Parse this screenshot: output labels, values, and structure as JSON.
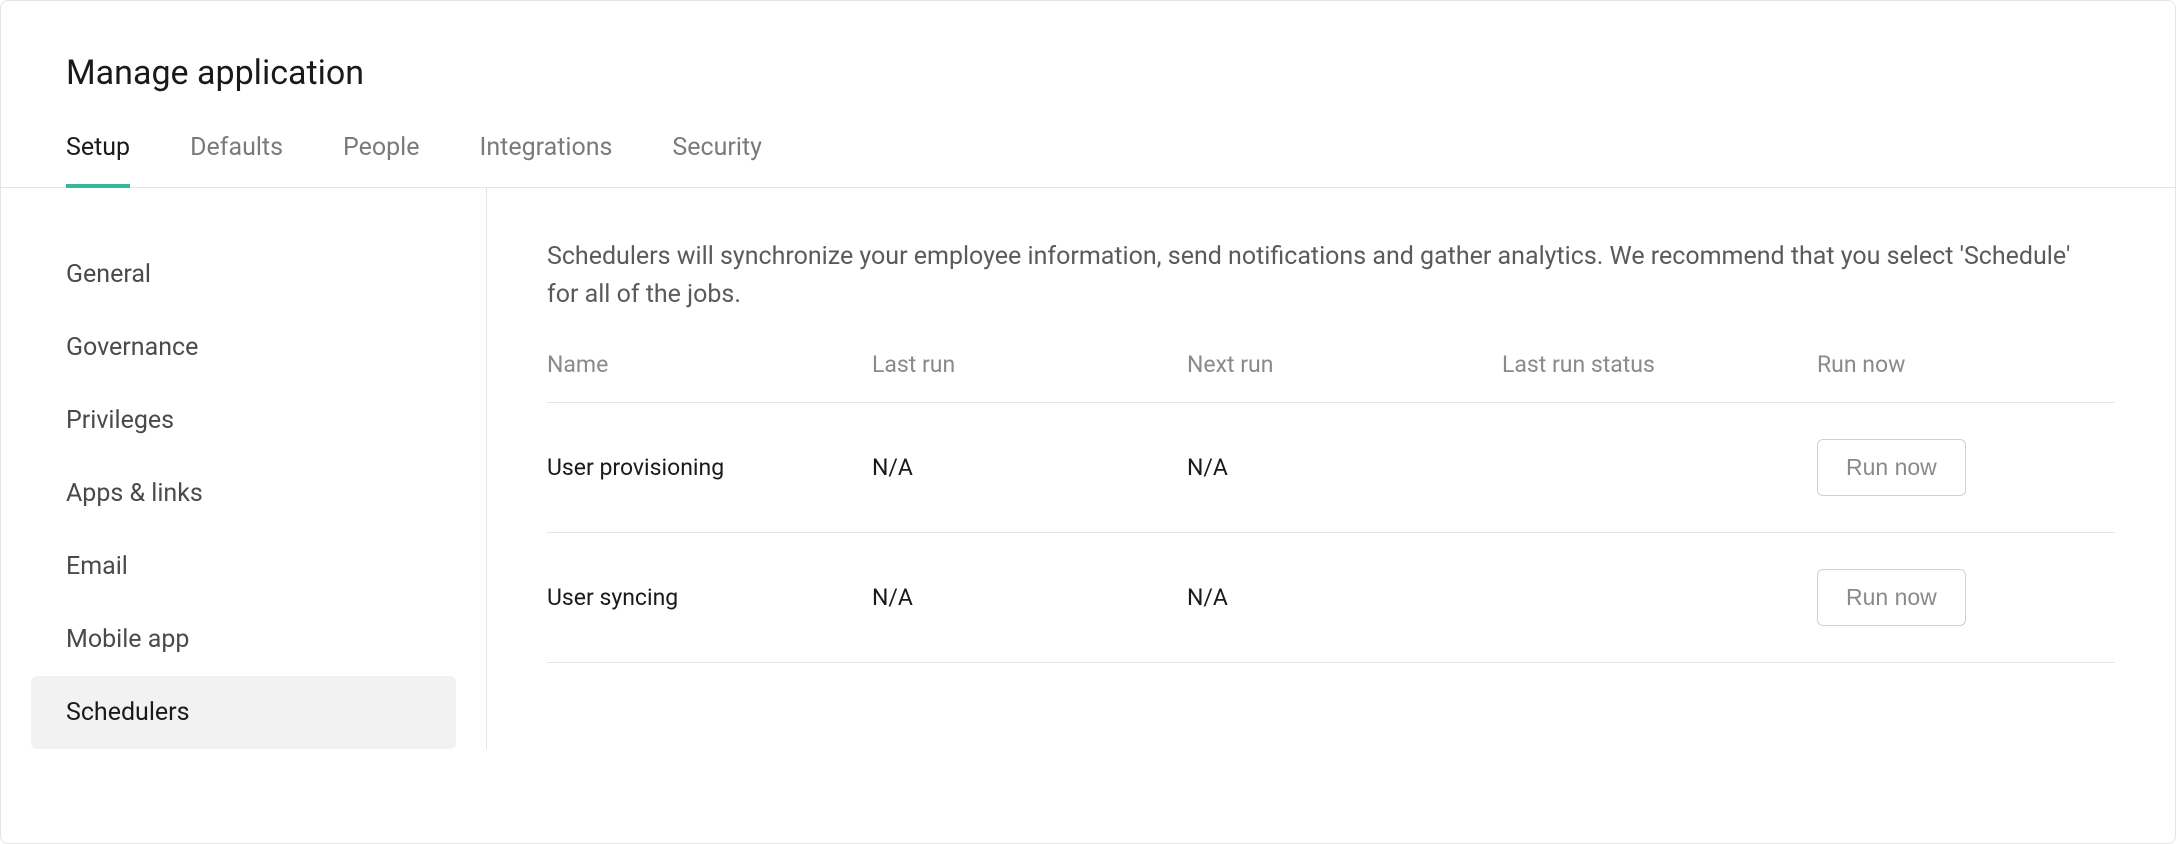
{
  "page": {
    "title": "Manage application"
  },
  "tabs": [
    {
      "label": "Setup",
      "active": true
    },
    {
      "label": "Defaults",
      "active": false
    },
    {
      "label": "People",
      "active": false
    },
    {
      "label": "Integrations",
      "active": false
    },
    {
      "label": "Security",
      "active": false
    }
  ],
  "sidebar": {
    "items": [
      {
        "label": "General",
        "active": false
      },
      {
        "label": "Governance",
        "active": false
      },
      {
        "label": "Privileges",
        "active": false
      },
      {
        "label": "Apps & links",
        "active": false
      },
      {
        "label": "Email",
        "active": false
      },
      {
        "label": "Mobile app",
        "active": false
      },
      {
        "label": "Schedulers",
        "active": true
      }
    ]
  },
  "main": {
    "description": "Schedulers will synchronize your employee information, send notifications and gather analytics. We recommend that you select 'Schedule' for all of the jobs.",
    "table": {
      "headers": {
        "name": "Name",
        "last_run": "Last run",
        "next_run": "Next run",
        "last_run_status": "Last run status",
        "run_now": "Run now"
      },
      "rows": [
        {
          "name": "User provisioning",
          "last_run": "N/A",
          "next_run": "N/A",
          "last_run_status": "",
          "run_now_label": "Run now"
        },
        {
          "name": "User syncing",
          "last_run": "N/A",
          "next_run": "N/A",
          "last_run_status": "",
          "run_now_label": "Run now"
        }
      ]
    }
  }
}
